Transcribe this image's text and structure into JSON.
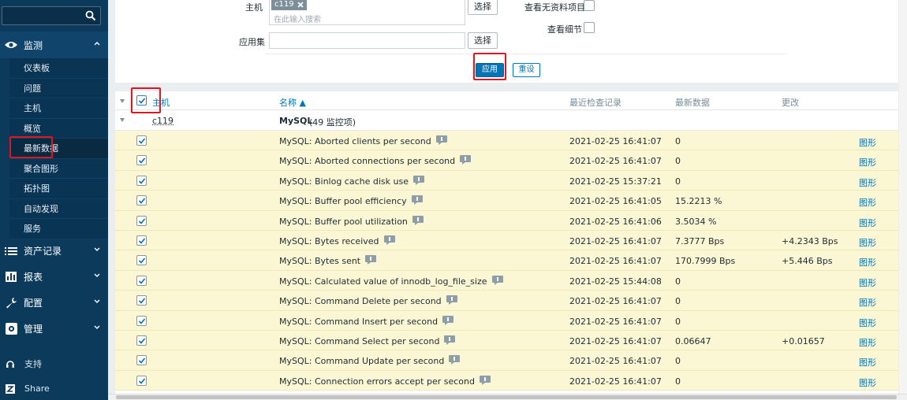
{
  "sidebar": {
    "sections": {
      "monitor": "监测",
      "assets": "资产记录",
      "reports": "报表",
      "config": "配置",
      "admin": "管理"
    },
    "submenu": [
      "仪表板",
      "问题",
      "主机",
      "概览",
      "最新数据",
      "聚合图形",
      "拓扑图",
      "自动发现",
      "服务"
    ],
    "support": "支持",
    "share": "Share"
  },
  "filter": {
    "host_label": "主机",
    "host_tag": "c119",
    "host_placeholder": "在此输入搜索",
    "appset_label": "应用集",
    "select_label": "选择",
    "show_nodata_label": "查看无资料项目",
    "show_details_label": "查看细节",
    "apply_label": "应用",
    "reset_label": "重设"
  },
  "table": {
    "headers": {
      "host": "主机",
      "name": "名称 ▲",
      "last_check": "最近检查记录",
      "last_value": "最新数据",
      "change": "更改"
    },
    "group": {
      "host": "c119",
      "name": "MySQL",
      "count": "(49 监控项)"
    },
    "graph_label": "图形",
    "rows": [
      {
        "name": "MySQL: Aborted clients per second",
        "time": "2021-02-25 16:41:07",
        "value": "0",
        "change": ""
      },
      {
        "name": "MySQL: Aborted connections per second",
        "time": "2021-02-25 16:41:07",
        "value": "0",
        "change": ""
      },
      {
        "name": "MySQL: Binlog cache disk use",
        "time": "2021-02-25 15:37:21",
        "value": "0",
        "change": ""
      },
      {
        "name": "MySQL: Buffer pool efficiency",
        "time": "2021-02-25 16:41:05",
        "value": "15.2213 %",
        "change": ""
      },
      {
        "name": "MySQL: Buffer pool utilization",
        "time": "2021-02-25 16:41:06",
        "value": "3.5034 %",
        "change": ""
      },
      {
        "name": "MySQL: Bytes received",
        "time": "2021-02-25 16:41:07",
        "value": "7.3777 Bps",
        "change": "+4.2343 Bps"
      },
      {
        "name": "MySQL: Bytes sent",
        "time": "2021-02-25 16:41:07",
        "value": "170.7999 Bps",
        "change": "+5.446 Bps"
      },
      {
        "name": "MySQL: Calculated value of innodb_log_file_size",
        "time": "2021-02-25 15:44:08",
        "value": "0",
        "change": ""
      },
      {
        "name": "MySQL: Command Delete per second",
        "time": "2021-02-25 16:41:07",
        "value": "0",
        "change": ""
      },
      {
        "name": "MySQL: Command Insert per second",
        "time": "2021-02-25 16:41:07",
        "value": "0",
        "change": ""
      },
      {
        "name": "MySQL: Command Select per second",
        "time": "2021-02-25 16:41:07",
        "value": "0.06647",
        "change": "+0.01657"
      },
      {
        "name": "MySQL: Command Update per second",
        "time": "2021-02-25 16:41:07",
        "value": "0",
        "change": ""
      },
      {
        "name": "MySQL: Connection errors accept per second",
        "time": "2021-02-25 16:41:07",
        "value": "0",
        "change": ""
      }
    ]
  },
  "colors": {
    "sidebar_bg": "#0c3a5b",
    "accent": "#0275b8",
    "row_highlight": "#fbf6d4",
    "annotation": "#e0161e"
  }
}
